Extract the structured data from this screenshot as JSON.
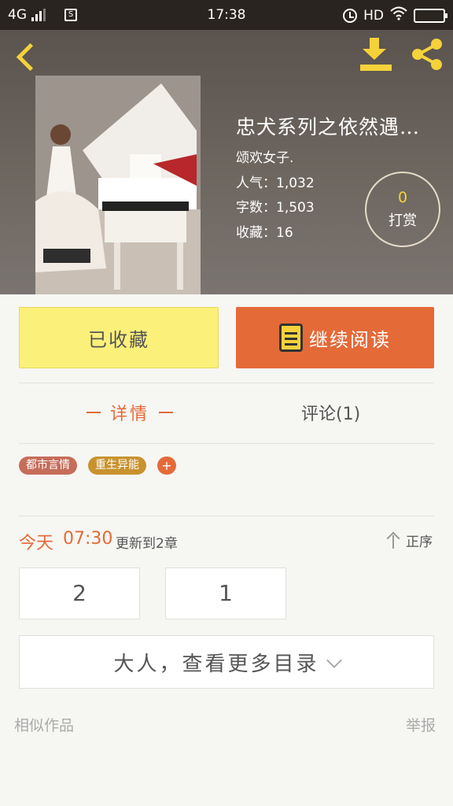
{
  "status_bar": {
    "network": "4G",
    "app_badge": "S",
    "time": "17:38",
    "hd_label": "HD"
  },
  "header": {
    "back_icon": "back-arrow-icon",
    "download_icon": "download-icon",
    "share_icon": "share-icon"
  },
  "book": {
    "title": "忠犬系列之依然遇…",
    "author": "颂欢女子.",
    "popularity": "人气：1,032",
    "word_count": "字数：1,503",
    "favorites": "收藏：16",
    "reward_count": "0",
    "reward_label": "打赏"
  },
  "actions": {
    "favorite_label": "已收藏",
    "read_label": "继续阅读",
    "read_icon": "book-icon"
  },
  "tabs": {
    "detail": "详情",
    "comment": "评论(1)"
  },
  "tags": [
    "都市言情",
    "重生异能"
  ],
  "tag_add": "+",
  "update": {
    "day": "今天",
    "time": "07:30",
    "text": "更新到2章",
    "order_label": "正序"
  },
  "chapters": [
    "2",
    "1"
  ],
  "more_toc": "大人，查看更多目录",
  "footer": {
    "similar": "相似作品",
    "report": "举报"
  },
  "colors": {
    "accent": "#e46a38",
    "yellow": "#f5d23a",
    "favorite_bg": "#fbf07a"
  }
}
